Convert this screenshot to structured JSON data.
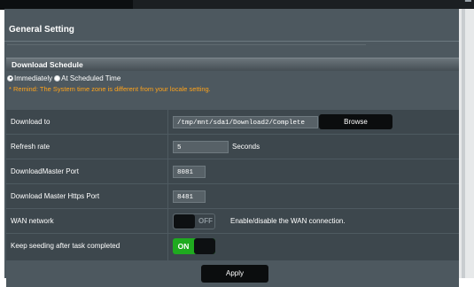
{
  "page": {
    "title": "General Setting"
  },
  "section": {
    "title": "Download Schedule"
  },
  "schedule": {
    "options": [
      "Immediately",
      "At Scheduled Time"
    ],
    "selected": "Immediately",
    "remind": "* Remind: The System time zone is different from your locale setting."
  },
  "settings": {
    "download_to": {
      "label": "Download to",
      "value": "/tmp/mnt/sda1/Download2/Complete",
      "browse_label": "Browse"
    },
    "refresh_rate": {
      "label": "Refresh rate",
      "value": "5",
      "unit": "Seconds"
    },
    "dm_port": {
      "label": "DownloadMaster Port",
      "value": "8081"
    },
    "https_port": {
      "label": "Download Master Https Port",
      "value": "8481"
    },
    "wan": {
      "label": "WAN network",
      "state": "OFF",
      "description": "Enable/disable the WAN connection."
    },
    "seeding": {
      "label": "Keep seeding after task completed",
      "state": "ON"
    }
  },
  "actions": {
    "apply_label": "Apply"
  },
  "colors": {
    "panel": "#4d585f",
    "table": "#3d474d",
    "remind": "#ffa31a",
    "toggle_on": "#1faa1f",
    "button": "#0b0d0e"
  },
  "icons": {
    "window_corner": "corner-glyph-icon"
  }
}
